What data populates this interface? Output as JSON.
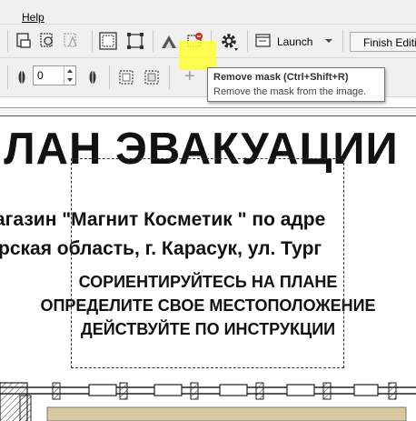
{
  "menu": {
    "help": "Help"
  },
  "toolbar": {
    "launch_label": "Launch",
    "finish_label": "Finish Editi",
    "spin_value": "0",
    "add_glyph": "+"
  },
  "tooltip": {
    "title": "Remove mask (Ctrl+Shift+R)",
    "description": "Remove the mask from the image."
  },
  "document": {
    "title": "ПЛАН ЭВАКУАЦИИ",
    "line1": "агазин \"Магнит Косметик \" по адре",
    "line2": "рская область, г. Карасук, ул. Тург",
    "instructions": [
      "СОРИЕНТИРУЙТЕСЬ НА ПЛАНЕ",
      "ОПРЕДЕЛИТЕ СВОЕ МЕСТОПОЛОЖЕНИЕ",
      "ДЕЙСТВУЙТЕ ПО ИНСТРУКЦИИ"
    ]
  },
  "colors": {
    "highlight": "#ffff33",
    "toolbar_bg": "#f0f0f0",
    "plan_floor": "#d9c9a0"
  },
  "icons": [
    "crop-icon",
    "mask-icon",
    "mask-disabled-icon",
    "frame-icon",
    "transform-icon",
    "checker-icon",
    "remove-mask-icon",
    "gear-icon",
    "launch-icon",
    "chevron-down-icon",
    "feather-icon",
    "select-rect-icon",
    "select-rect2-icon",
    "add-icon"
  ]
}
